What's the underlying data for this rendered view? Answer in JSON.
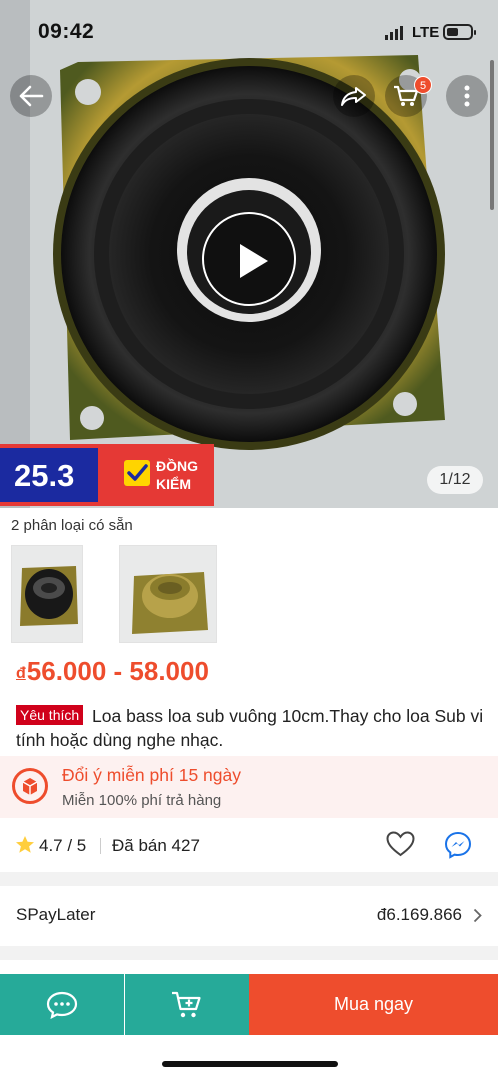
{
  "status_bar": {
    "time": "09:42",
    "network": "LTE"
  },
  "header": {
    "cart_count": "5"
  },
  "media": {
    "pager": "1/12",
    "promo_number": "25.3",
    "promo_text_1": "ĐỒNG",
    "promo_text_2": "KIỂM"
  },
  "variants": {
    "label": "2 phân loại có sẵn"
  },
  "product": {
    "currency": "đ",
    "price_range": "56.000 - 58.000",
    "badge": "Yêu thích",
    "title": "Loa bass loa sub vuông 10cm.Thay cho loa Sub vi tính hoặc dùng nghe nhạc."
  },
  "returns": {
    "title": "Đổi ý miễn phí 15 ngày",
    "subtitle": "Miễn 100% phí trả hàng"
  },
  "rating": {
    "value": "4.7 / 5",
    "sold": "Đã bán 427"
  },
  "spaylater": {
    "label": "SPayLater",
    "value": "đ6.169.866"
  },
  "bottom_bar": {
    "buy_label": "Mua ngay"
  },
  "colors": {
    "accent": "#ee4d2d",
    "teal": "#26aa99"
  }
}
